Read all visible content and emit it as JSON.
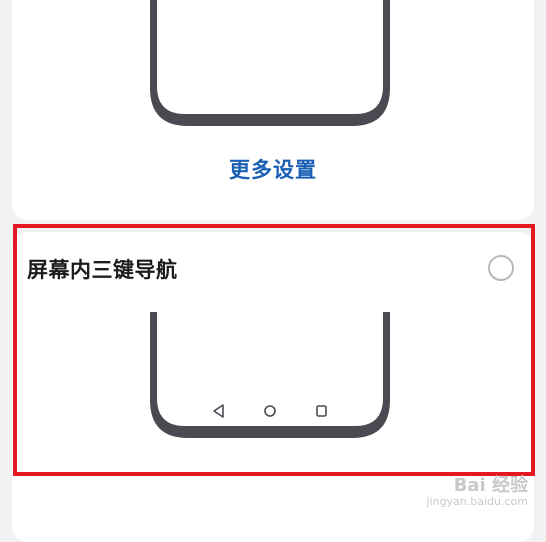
{
  "top_option": {
    "more_settings_label": "更多设置"
  },
  "nav_option": {
    "title": "屏幕内三键导航",
    "selected": false,
    "buttons": {
      "back": "back-triangle-icon",
      "home": "home-circle-icon",
      "recents": "recents-square-icon"
    }
  },
  "watermark": {
    "brand": "Bai 经验",
    "url": "jingyan.baidu.com"
  },
  "colors": {
    "accent": "#1a5fb4",
    "phone_frame": "#4a4a52",
    "highlight": "#e51923"
  }
}
